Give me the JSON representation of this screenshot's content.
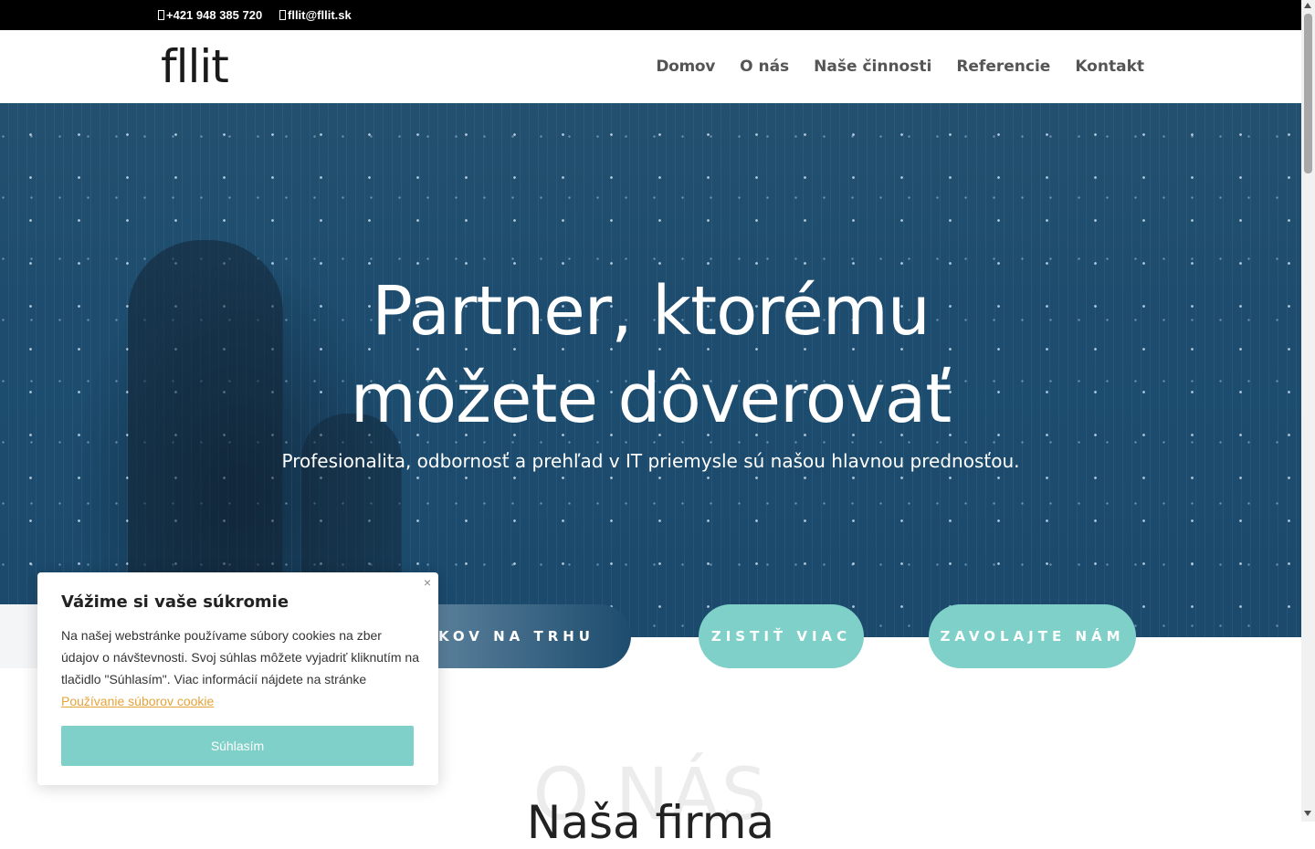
{
  "topbar": {
    "phone": "+421 948 385 720",
    "email": "fllit@fllit.sk"
  },
  "header": {
    "logo": "fllit",
    "nav": [
      "Domov",
      "O nás",
      "Naše činnosti",
      "Referencie",
      "Kontakt"
    ]
  },
  "hero": {
    "title_line1": "Partner, ktorému",
    "title_line2": "môžete dôverovať",
    "subtitle": "Profesionalita, odbornosť a prehľad v IT priemysle sú našou hlavnou prednosťou."
  },
  "buttons": {
    "btn1": "OKOV NA TRHU",
    "btn2": "ZISTIŤ VIAC",
    "btn3": "ZAVOLAJTE NÁM"
  },
  "about": {
    "ghost": "O NÁS",
    "title": "Naša firma"
  },
  "cookie": {
    "close": "×",
    "title": "Vážime si vaše súkromie",
    "text": "Na našej webstránke používame súbory cookies na zber údajov o návštevnosti. Svoj súhlas môžete vyjadriť kliknutím na tlačidlo \"Súhlasím\". Viac informácií nájdete na stránke ",
    "link": "Používanie súborov cookie",
    "accept": "Súhlasím"
  },
  "colors": {
    "accent": "#7fd0c8",
    "hero_blue": "#1d4c6e",
    "link": "#e5a33a"
  }
}
